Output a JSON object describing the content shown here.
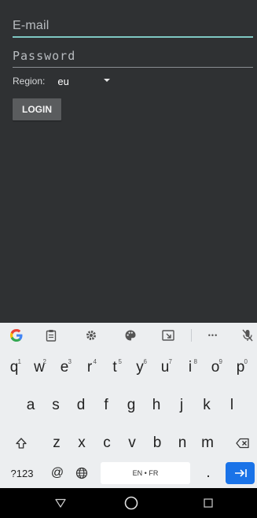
{
  "login_form": {
    "email_placeholder": "E-mail",
    "password_placeholder": "Password",
    "region_label": "Region:",
    "region_value": "eu",
    "login_button": "LOGIN"
  },
  "keyboard": {
    "toolbar_icons": [
      "google-icon",
      "clipboard-icon",
      "settings-gear-icon",
      "palette-icon",
      "resize-icon",
      "more-icon",
      "mic-off-icon"
    ],
    "row1": [
      {
        "key": "q",
        "hint": "1"
      },
      {
        "key": "w",
        "hint": "2"
      },
      {
        "key": "e",
        "hint": "3"
      },
      {
        "key": "r",
        "hint": "4"
      },
      {
        "key": "t",
        "hint": "5"
      },
      {
        "key": "y",
        "hint": "6"
      },
      {
        "key": "u",
        "hint": "7"
      },
      {
        "key": "i",
        "hint": "8"
      },
      {
        "key": "o",
        "hint": "9"
      },
      {
        "key": "p",
        "hint": "0"
      }
    ],
    "row2": [
      "a",
      "s",
      "d",
      "f",
      "g",
      "h",
      "j",
      "k",
      "l"
    ],
    "row3": [
      "z",
      "x",
      "c",
      "v",
      "b",
      "n",
      "m"
    ],
    "symbols_key": "?123",
    "at_key": "@",
    "space_label": "EN • FR",
    "period_key": ".",
    "more_label": "•••"
  },
  "colors": {
    "app_background": "#2f3133",
    "accent_underline": "#7ec8c2",
    "enter_key": "#1a73e8"
  }
}
